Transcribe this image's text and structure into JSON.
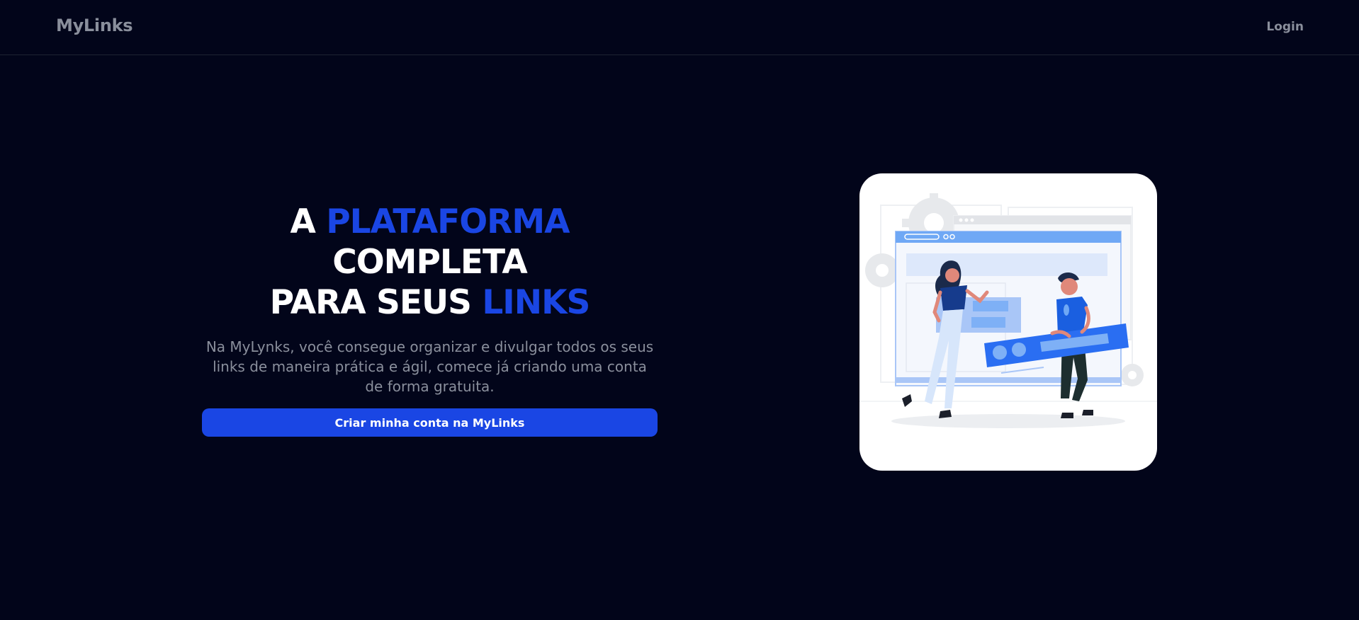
{
  "header": {
    "brand": "MyLinks",
    "login_label": "Login"
  },
  "hero": {
    "headline": {
      "part1": "A ",
      "highlight1": "PLATAFORMA",
      "part2": " COMPLETA",
      "part3": "PARA SEUS ",
      "highlight2": "LINKS"
    },
    "description": "Na MyLynks, você consegue organizar e divulgar todos os seus links de maneira prática e ágil, comece já criando uma conta de forma gratuita.",
    "cta_label": "Criar minha conta na MyLinks"
  },
  "illustration": {
    "icon": "people-building-website-illustration"
  },
  "colors": {
    "background": "#02051a",
    "accent": "#1a46e4",
    "muted_text": "#8a8f9c",
    "card": "#ffffff"
  }
}
